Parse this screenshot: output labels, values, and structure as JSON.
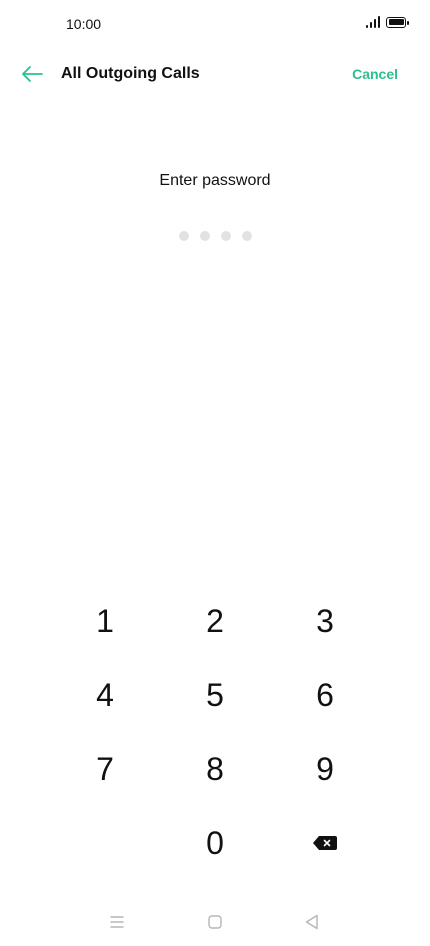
{
  "status_bar": {
    "time": "10:00",
    "signal_icon": "signal-icon",
    "battery_icon": "battery-icon"
  },
  "header": {
    "back_icon": "arrow-left-icon",
    "title": "All Outgoing Calls",
    "cancel_label": "Cancel"
  },
  "prompt": {
    "label": "Enter password",
    "digits_required": 4,
    "digits_entered": 0
  },
  "keypad": {
    "rows": [
      [
        "1",
        "2",
        "3"
      ],
      [
        "4",
        "5",
        "6"
      ],
      [
        "7",
        "8",
        "9"
      ],
      [
        "",
        "0",
        "backspace-icon"
      ]
    ]
  },
  "nav_bar": {
    "icons": [
      "menu-icon",
      "home-square-icon",
      "back-triangle-icon"
    ]
  },
  "colors": {
    "accent": "#2dc08c",
    "text": "#111111",
    "dot_empty": "#e2e2e2",
    "nav_icon": "#b5b5b5",
    "background": "#ffffff"
  }
}
